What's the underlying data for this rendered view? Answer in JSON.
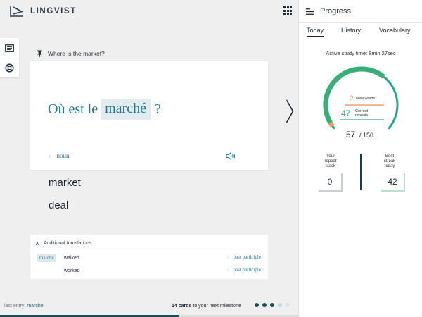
{
  "app": {
    "name": "LINGVIST"
  },
  "exercise": {
    "hint": "Where is the market?",
    "sentence_before": "Où est le",
    "gap_word": "marché",
    "sentence_after": "?",
    "word_type": "noun",
    "translations": [
      "market",
      "deal"
    ]
  },
  "additional": {
    "title": "Additional translations",
    "source_word": "marché",
    "rows": [
      {
        "word": "walked",
        "type": "past participle"
      },
      {
        "word": "worked",
        "type": "past participle"
      }
    ]
  },
  "footer": {
    "last_entry_label": "last entry:",
    "last_entry_value": "marche",
    "milestone_count": "14 cards",
    "milestone_text": "to your next milestone",
    "dots": [
      "#1d4e5a",
      "#1d4e5a",
      "#1d4e5a",
      "#b9d7dc",
      "#d8e6e9"
    ],
    "progress_fraction": 0.6
  },
  "panel": {
    "title": "Progress",
    "tabs": [
      "Today",
      "History",
      "Vocabulary"
    ],
    "active_tab": "Today",
    "study_time": "Active study time: 8min 27sec",
    "new_words_count": "2",
    "new_words_label": "New words",
    "repeats_count": "47",
    "repeats_label_1": "Correct",
    "repeats_label_2": "repeats",
    "total_done": "57",
    "total_goal": "/ 150",
    "gauge_fraction": 0.38,
    "repeat_stack_label_1": "Your",
    "repeat_stack_label_2": "repeat",
    "repeat_stack_label_3": "stack",
    "repeat_stack_value": "0",
    "streak_label_1": "Best",
    "streak_label_2": "streak",
    "streak_label_3": "today",
    "streak_value": "42"
  },
  "colors": {
    "accent": "#1f7a8c",
    "new_words": "#f0a066",
    "repeats": "#3aae79",
    "gauge_track": "#2aa58f"
  }
}
